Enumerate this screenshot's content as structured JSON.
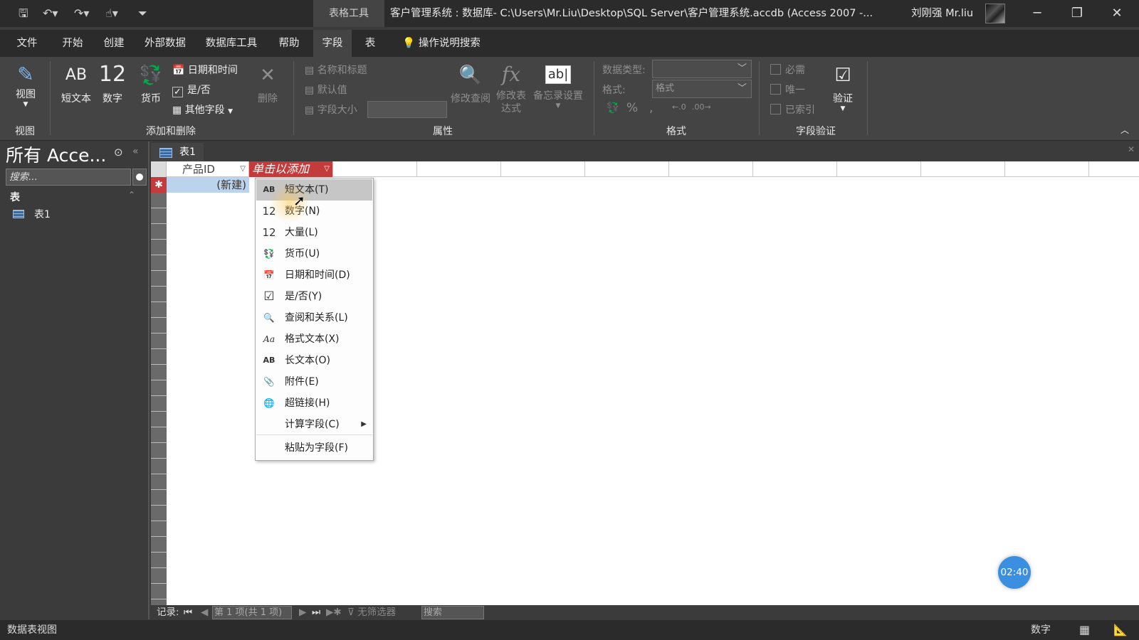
{
  "titlebar": {
    "context_tab": "表格工具",
    "window_title": "客户管理系统 : 数据库- C:\\Users\\Mr.Liu\\Desktop\\SQL Server\\客户管理系统.accdb (Access 2007 -...",
    "user_name": "刘刚强 Mr.liu"
  },
  "menu": {
    "tabs": [
      "文件",
      "开始",
      "创建",
      "外部数据",
      "数据库工具",
      "帮助",
      "字段",
      "表"
    ],
    "active_tab": "字段",
    "tell_me": "操作说明搜索"
  },
  "ribbon": {
    "views": {
      "view_label": "视图",
      "group_label": "视图"
    },
    "add_delete": {
      "short_text": "短文本",
      "short_text_icon": "AB",
      "number": "数字",
      "number_icon": "12",
      "currency": "货币",
      "date_time": "日期和时间",
      "yes_no": "是/否",
      "more_fields": "其他字段",
      "delete": "删除",
      "group_label": "添加和删除"
    },
    "properties": {
      "name_caption": "名称和标题",
      "default_value": "默认值",
      "field_size": "字段大小",
      "modify_lookups": "修改查阅",
      "modify_expression": "修改表达式",
      "memo_settings": "备忘录设置",
      "memo_icon": "ab|",
      "group_label": "属性"
    },
    "formatting": {
      "data_type_label": "数据类型:",
      "format_label": "格式:",
      "format_value": "格式",
      "percent": "%",
      "comma": ",",
      "group_label": "格式"
    },
    "validation": {
      "required": "必需",
      "unique": "唯一",
      "indexed": "已索引",
      "validate": "验证",
      "group_label": "字段验证"
    }
  },
  "navpane": {
    "title": "所有 Acce...",
    "search_placeholder": "搜索...",
    "group": "表",
    "items": [
      "表1"
    ]
  },
  "document": {
    "tab_label": "表1",
    "columns": [
      "产品ID",
      "单击以添加"
    ],
    "new_row_marker": "✱",
    "new_row_text": "(新建)"
  },
  "context_menu": {
    "items": [
      {
        "icon": "AB",
        "label": "短文本(T)"
      },
      {
        "icon": "12",
        "label": "数字(N)"
      },
      {
        "icon": "12",
        "label": "大量(L)"
      },
      {
        "icon": "currency-icon",
        "label": "货币(U)"
      },
      {
        "icon": "calendar-icon",
        "label": "日期和时间(D)"
      },
      {
        "icon": "checkbox-icon",
        "label": "是/否(Y)"
      },
      {
        "icon": "lookup-icon",
        "label": "查阅和关系(L)"
      },
      {
        "icon": "Aa",
        "label": "格式文本(X)"
      },
      {
        "icon": "AB",
        "label": "长文本(O)"
      },
      {
        "icon": "paperclip-icon",
        "label": "附件(E)"
      },
      {
        "icon": "globe-link-icon",
        "label": "超链接(H)"
      },
      {
        "icon": "",
        "label": "计算字段(C)"
      },
      {
        "icon": "",
        "label": "粘贴为字段(F)"
      }
    ],
    "hover_index": 0
  },
  "record_nav": {
    "label": "记录:",
    "position": "第 1 项(共 1 项)",
    "filter": "无筛选器",
    "search": "搜索"
  },
  "statusbar": {
    "view_name": "数据表视图",
    "mode": "数字"
  },
  "timer": "02:40",
  "colors": {
    "accent_red": "#c43b3b",
    "selection_blue": "#bcd3ee",
    "timer_blue": "#3b8fe0"
  }
}
